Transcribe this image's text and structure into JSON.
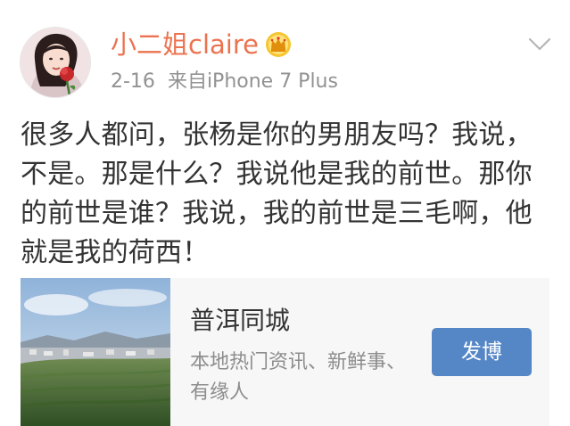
{
  "post": {
    "author": "小二姐claire",
    "time": "2-16",
    "source": "来自iPhone 7 Plus",
    "text": "很多人都问，张杨是你的男朋友吗？我说，不是。那是什么？我说他是我的前世。那你的前世是谁？我说，我的前世是三毛啊，他就是我的荷西！"
  },
  "icons": {
    "avatar": "avatar-photo",
    "badge": "crown-icon",
    "menu": "chevron-down-icon"
  },
  "card": {
    "title": "普洱同城",
    "description": "本地热门资讯、新鲜事、有缘人",
    "button_label": "发博"
  },
  "colors": {
    "username": "#eb7350",
    "meta": "#929292",
    "body_text": "#333333",
    "card_bg": "#f7f7f7",
    "button_bg": "#5586c6"
  }
}
